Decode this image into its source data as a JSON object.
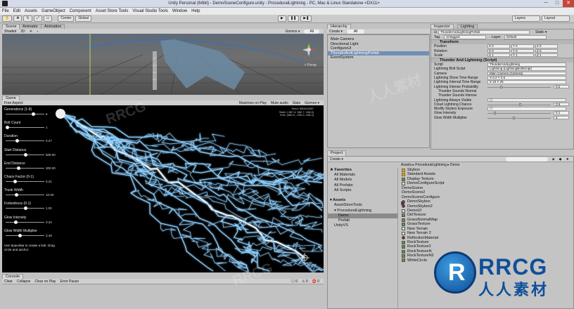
{
  "window": {
    "title": "Unity Personal (64bit) - DemoSceneConfigure.unity - ProceduralLightning - PC, Mac & Linux Standalone <DX11>",
    "min": "─",
    "max": "□",
    "close": "✕"
  },
  "menu": [
    "File",
    "Edit",
    "Assets",
    "GameObject",
    "Component",
    "Asset Store Tools",
    "Visual Studio Tools",
    "Window",
    "Help"
  ],
  "toolbar": {
    "pivot": "Center",
    "space": "Global",
    "play": "▶",
    "pause": "❚❚",
    "step": "▶❚",
    "layers": "Layers",
    "layout": "Layout"
  },
  "scene": {
    "tabs": [
      "Scene",
      "Animator",
      "Animation"
    ],
    "shading": "Shaded",
    "mode": "2D",
    "gizmos": "Gizmos ▾",
    "search": "All",
    "persp": "< Persp"
  },
  "game": {
    "tab": "Game",
    "aspect": "Free Aspect",
    "buttons": [
      "Maximize on Play",
      "Mute audio",
      "Stats",
      "Gizmos ▾"
    ],
    "stats": [
      "Seed: 880041857",
      "Start: (-387.4, 380.7, 168.0)",
      "End: (460.0, -330.0, 168.0)"
    ],
    "controls": [
      {
        "label": "Generations (1-8)",
        "value": "6",
        "fill": 0.71
      },
      {
        "label": "Bolt Count",
        "value": "1",
        "fill": 0.0
      },
      {
        "label": "Duration",
        "value": "0.27",
        "fill": 0.27
      },
      {
        "label": "Start Distance",
        "value": "500.00",
        "fill": 0.5
      },
      {
        "label": "End Distance",
        "value": "300.00",
        "fill": 0.3
      },
      {
        "label": "Chaos Factor (0-1)",
        "value": "0.21",
        "fill": 0.21
      },
      {
        "label": "Trunk Width",
        "value": "10.00",
        "fill": 0.25
      },
      {
        "label": "Forkedness (0-1)",
        "value": "1.00",
        "fill": 0.5
      },
      {
        "label": "Glow Intensity",
        "value": "0.24",
        "fill": 0.24
      },
      {
        "label": "Glow Width Multiplier",
        "value": "3.49",
        "fill": 0.35
      }
    ],
    "note": "Use Spacebar to create a bolt. Drag circle and anchor."
  },
  "console": {
    "tab": "Console",
    "buttons": [
      "Clear",
      "Collapse",
      "Clear on Play",
      "Error Pause"
    ],
    "counts": [
      "0",
      "0",
      "0"
    ]
  },
  "hierarchy": {
    "tab": "Hierarchy",
    "create": "Create ▾",
    "search": "All",
    "items": [
      {
        "label": "Main Camera",
        "selected": false
      },
      {
        "label": "Directional Light",
        "selected": false
      },
      {
        "label": "ConfigureUI",
        "selected": false
      },
      {
        "label": "ThunderAndLightningPrefab",
        "selected": true
      },
      {
        "label": "EventSystem",
        "selected": false
      }
    ]
  },
  "inspector": {
    "tabs": [
      "Inspector",
      "Lighting"
    ],
    "object_name": "ThunderAndLightningPrefab",
    "static": "Static ▾",
    "tag_label": "Tag",
    "tag": "Untagged",
    "layer_label": "Layer",
    "layer": "Default",
    "transform": {
      "header": "Transform",
      "rows": [
        {
          "label": "Position",
          "x": "X 0",
          "y": "Y 0",
          "z": "Z 0"
        },
        {
          "label": "Rotation",
          "x": "X 0",
          "y": "Y 0",
          "z": "Z 0"
        },
        {
          "label": "Scale",
          "x": "X 1",
          "y": "Y 1",
          "z": "Z 1"
        }
      ]
    },
    "script_comp": {
      "header": "Thunder And Lightning (Script)",
      "rows": [
        {
          "label": "Script",
          "value": "ThunderAndLightning"
        },
        {
          "label": "Lightning Bolt Script",
          "value": "Lightning (LightningBoltScript)"
        },
        {
          "label": "Camera",
          "value": "Main Camera (Camera)"
        },
        {
          "label": "Lightning Show Time Range",
          "value": "X 0.2   Y 0.5"
        },
        {
          "label": "Lightning Interval Time Range",
          "value": "X 10   Y 25"
        },
        {
          "label": "Lightning Intense Probability",
          "value": "0.2",
          "slider": 0.2
        },
        {
          "label": "Thunder Sounds Normal",
          "value": ""
        },
        {
          "label": "Thunder Sounds Intense",
          "value": ""
        },
        {
          "label": "Lightning Always Visible",
          "value": "☐"
        },
        {
          "label": "Cloud Lightning Chance",
          "value": "0.5",
          "slider": 0.5
        },
        {
          "label": "Modify Skybox Exposure",
          "value": "☐"
        },
        {
          "label": "Glow Intensity",
          "value": "0.1",
          "slider": 0.1
        },
        {
          "label": "Glow Width Multiplier",
          "value": "4",
          "slider": 0.4
        }
      ]
    }
  },
  "project": {
    "tab": "Project",
    "create": "Create ▾",
    "breadcrumb": "Assets ▸ ProceduralLightning ▸ Demo",
    "tree": [
      {
        "label": "★ Favorites",
        "indent": 0,
        "bold": true
      },
      {
        "label": "All Materials",
        "indent": 2
      },
      {
        "label": "All Models",
        "indent": 2
      },
      {
        "label": "All Prefabs",
        "indent": 2
      },
      {
        "label": "All Scripts",
        "indent": 2
      },
      {
        "label": "",
        "indent": 0
      },
      {
        "label": "▾ Assets",
        "indent": 0,
        "bold": true
      },
      {
        "label": "AssetStoreTools",
        "indent": 2
      },
      {
        "label": "▾ ProceduralLightning",
        "indent": 2
      },
      {
        "label": "Demo",
        "indent": 4,
        "selected": true
      },
      {
        "label": "Prefab",
        "indent": 4
      },
      {
        "label": "UnityVS",
        "indent": 2
      }
    ],
    "assets": [
      {
        "label": "Skybox",
        "icon": "folder"
      },
      {
        "label": "Standard Assets",
        "icon": "folder"
      },
      {
        "label": "Display Texture",
        "icon": "tex"
      },
      {
        "label": "DemoConfigureScript",
        "icon": "script"
      },
      {
        "label": "DemoScene",
        "icon": "scene"
      },
      {
        "label": "DemoScene2",
        "icon": "scene"
      },
      {
        "label": "DemoSceneConfigure",
        "icon": "scene"
      },
      {
        "label": "DemoSkybox",
        "icon": "mat"
      },
      {
        "label": "DemoSkybox2",
        "icon": "mat"
      },
      {
        "label": "DemoUI",
        "icon": "script"
      },
      {
        "label": "DirtTexture",
        "icon": "tex"
      },
      {
        "label": "GrassNormalMap",
        "icon": "tex"
      },
      {
        "label": "GrassTexture",
        "icon": "tex"
      },
      {
        "label": "New Terrain",
        "icon": "script"
      },
      {
        "label": "New Terrain 2",
        "icon": "script"
      },
      {
        "label": "ReflectionMaterial",
        "icon": "mat"
      },
      {
        "label": "RockTexture",
        "icon": "tex"
      },
      {
        "label": "RockTexture2",
        "icon": "tex"
      },
      {
        "label": "RockTextureN",
        "icon": "tex"
      },
      {
        "label": "RockTextureN2",
        "icon": "tex"
      },
      {
        "label": "WhiteCircle",
        "icon": "tex"
      }
    ]
  },
  "watermark": {
    "text": "RRCG",
    "sub": "人人素材"
  },
  "colors": {
    "selection": "#6f8fb8",
    "game_bg": "#000000",
    "bolt": "#8fd0ff"
  }
}
